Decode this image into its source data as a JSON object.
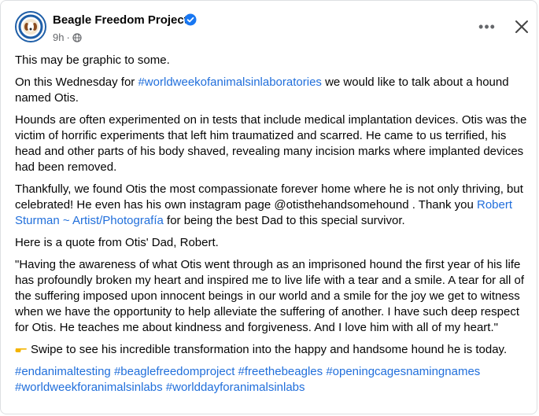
{
  "post": {
    "page_name": "Beagle Freedom Project",
    "timestamp": "9h",
    "timestamp_separator": "·",
    "more_label": "•••",
    "close_label": "close"
  },
  "content": {
    "p1": "This may be graphic to some.",
    "p2_before": "On this Wednesday for ",
    "p2_hashtag": "#worldweekofanimalsinlaboratories",
    "p2_after": " we would like to talk about a hound named Otis.",
    "p3": "Hounds are often experimented on in tests that include medical  implantation devices. Otis was the victim of horrific experiments that left him traumatized and scarred. He came to us terrified, his head and other parts of his body shaved, revealing many incision marks where implanted devices had been removed.",
    "p4_before": "Thankfully, we found Otis the most compassionate forever home where he is not only thriving, but celebrated! He even has his own instagram page @otisthehandsomehound . Thank you ",
    "p4_link": "Robert Sturman ~ Artist/Photografía",
    "p4_after": " for being the best Dad to this special survivor.",
    "p5": "Here is a quote from Otis' Dad, Robert.",
    "p6": "\"Having the awareness of what Otis went through as an imprisoned hound the first year of his life has profoundly broken my heart and inspired me to live life with a tear and a smile.  A tear for all of the suffering imposed upon innocent beings in our world and a smile for the joy we get to witness when we have the opportunity to help alleviate the suffering of another. I have such deep respect for Otis. He teaches me about kindness and forgiveness. And I love him with all of my heart.\"",
    "p7": "Swipe to see his incredible transformation into the happy and handsome hound he is today.",
    "hashtags": [
      "#endanimaltesting",
      "#beaglefreedomproject",
      "#freethebeagles",
      "#openingcagesnamingnames",
      "#worldweekforanimalsinlabs",
      "#worlddayforanimalsinlabs"
    ]
  },
  "colors": {
    "link": "#216fdb",
    "verified": "#1877f2",
    "secondary_text": "#65676b"
  },
  "icons": [
    "verified-badge-icon",
    "globe-icon",
    "more-icon",
    "close-icon",
    "pointing-hand-icon"
  ]
}
